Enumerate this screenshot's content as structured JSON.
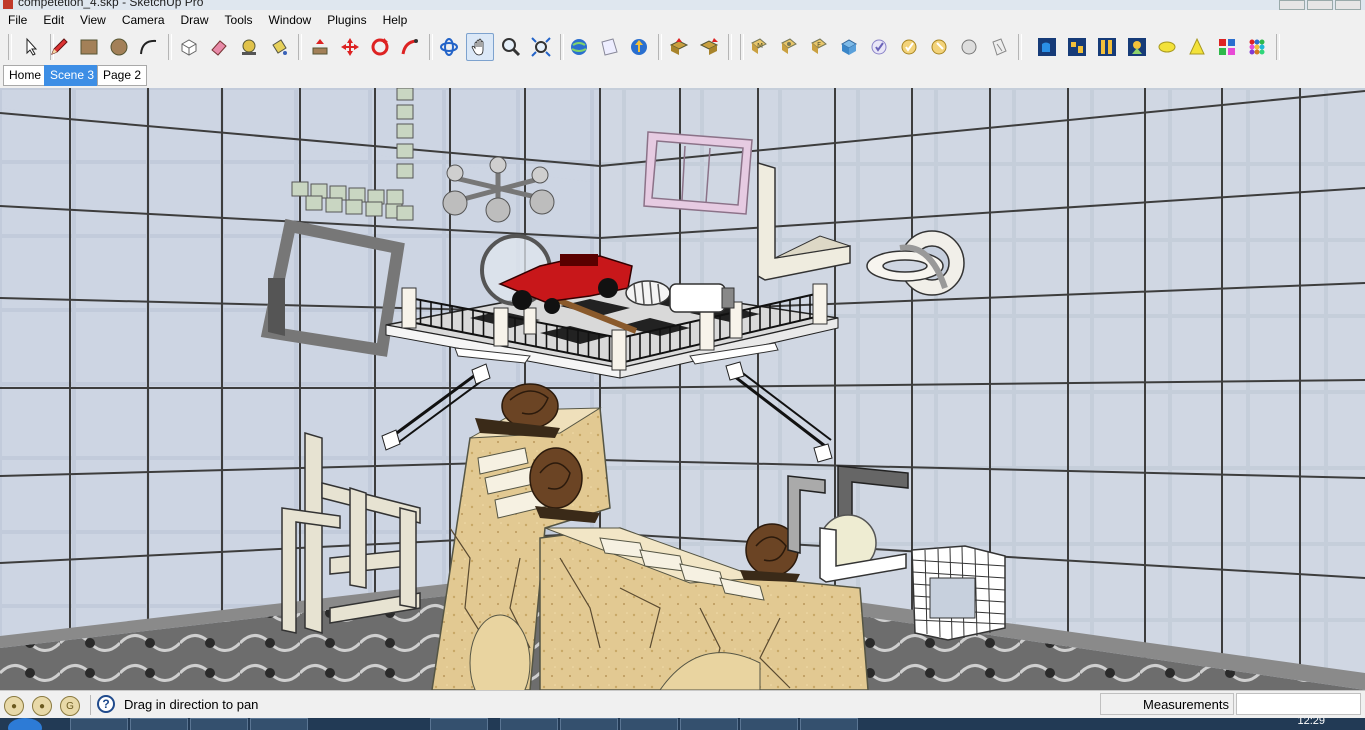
{
  "window": {
    "title": "competetion_4.skp - SketchUp Pro"
  },
  "menu": [
    "File",
    "Edit",
    "View",
    "Camera",
    "Draw",
    "Tools",
    "Window",
    "Plugins",
    "Help"
  ],
  "toolbar": {
    "groups": [
      [
        "select-tool"
      ],
      [
        "pencil-tool",
        "rectangle-tool",
        "circle-tool",
        "arc-tool"
      ],
      [
        "make-component-tool",
        "eraser-tool",
        "tape-measure-tool",
        "paint-bucket-tool"
      ],
      [
        "push-pull-tool",
        "move-tool",
        "rotate-tool",
        "follow-me-tool"
      ],
      [
        "orbit-tool",
        "pan-tool",
        "zoom-tool",
        "zoom-extents-tool"
      ],
      [
        "get-models-tool",
        "share-model-tool",
        "upload-tool"
      ],
      [
        "get-component-tool",
        "share-component-tool"
      ],
      [
        "style-xray-tool",
        "style-backedges-tool",
        "style-wireframe-tool",
        "style-hidden-line-tool",
        "style-shaded-tool",
        "style-textured-tool",
        "style-monochrome-tool",
        "style-sketchy-tool",
        "style-edge-tool"
      ],
      [
        "shadows-tool",
        "fog-tool",
        "section-plane-tool",
        "terrain-tool",
        "sun-tool",
        "cone-tool",
        "color-grid-tool",
        "color-dots-tool"
      ]
    ]
  },
  "scenes": [
    "Home",
    "Scene 3",
    "Page 2"
  ],
  "active_scene": "Scene 3",
  "status": {
    "text": "Drag in direction to pan",
    "measurements_label": "Measurements",
    "measurements_value": ""
  },
  "taskbar": {
    "clock": "12:29"
  }
}
